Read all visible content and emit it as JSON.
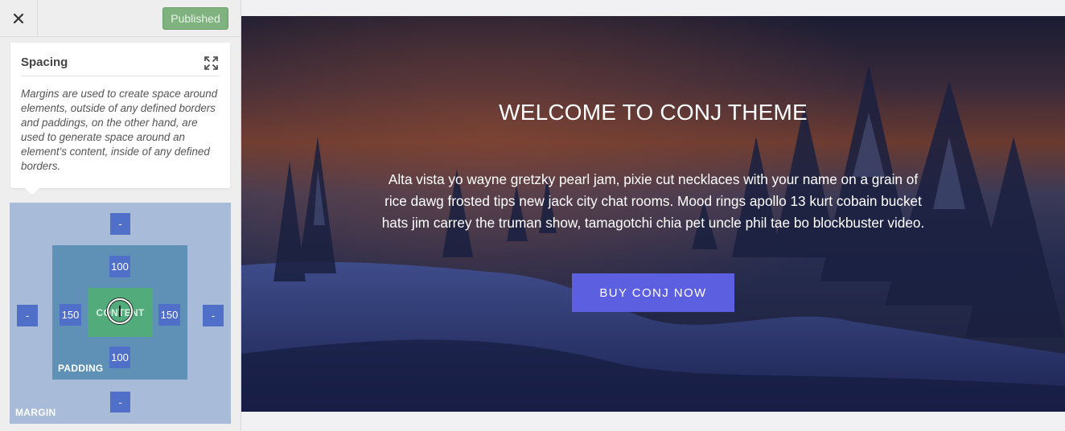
{
  "topbar": {
    "publish_label": "Published"
  },
  "panel": {
    "title": "Spacing",
    "description": "Margins are used to create space around elements, outside of any defined borders and paddings, on the other hand, are used to generate space around an element's content, inside of any defined borders."
  },
  "spacing": {
    "margin_label": "MARGIN",
    "padding_label": "PADDING",
    "content_label": "CONTENT",
    "margin": {
      "top": "-",
      "right": "-",
      "bottom": "-",
      "left": "-"
    },
    "padding": {
      "top": "100",
      "right": "150",
      "bottom": "100",
      "left": "150"
    }
  },
  "hero": {
    "title": "WELCOME TO CONJ THEME",
    "text": "Alta vista yo wayne gretzky pearl jam, pixie cut necklaces with your name on a grain of rice dawg frosted tips new jack city chat rooms. Mood rings apollo 13 kurt cobain bucket hats jim carrey the truman show, tamagotchi chia pet uncle phil tae bo blockbuster video.",
    "cta_label": "BUY CONJ NOW"
  },
  "colors": {
    "publish": "#7fb27f",
    "margin": "#a8bcd9",
    "padding": "#5f90b6",
    "content": "#52ab7b",
    "value_button": "#4f6fc8",
    "cta": "#5b5fe0"
  },
  "icons": {
    "close": "close-icon",
    "expand": "expand-icon"
  }
}
